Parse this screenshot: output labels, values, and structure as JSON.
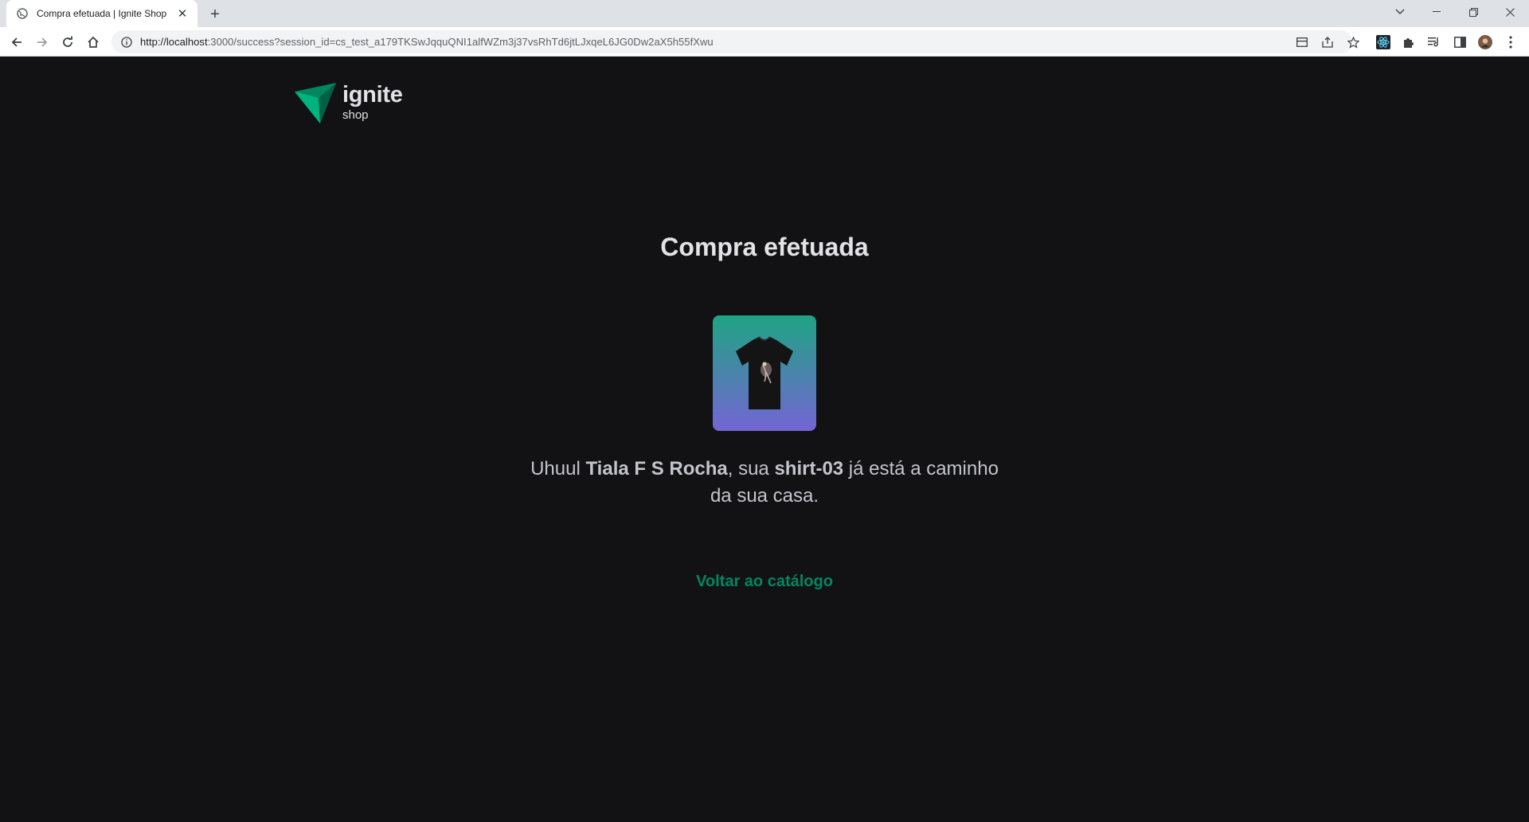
{
  "browser": {
    "tab_title": "Compra efetuada | Ignite Shop",
    "url_host": "http://localhost",
    "url_rest": ":3000/success?session_id=cs_test_a179TKSwJqquQNI1alfWZm3j37vsRhTd6jtLJxqeL6JG0Dw2aX5h55fXwu"
  },
  "logo": {
    "name": "ignite",
    "sub": "shop"
  },
  "page": {
    "title": "Compra efetuada",
    "message_prefix": "Uhuul ",
    "customer_name": "Tiala F S Rocha",
    "message_middle": ", sua ",
    "product_name": "shirt-03",
    "message_suffix": " já está a caminho da sua casa.",
    "back_link": "Voltar ao catálogo"
  },
  "colors": {
    "background": "#121214",
    "accent": "#00875f",
    "gradient_top": "#1ea483",
    "gradient_bottom": "#7465d4"
  }
}
